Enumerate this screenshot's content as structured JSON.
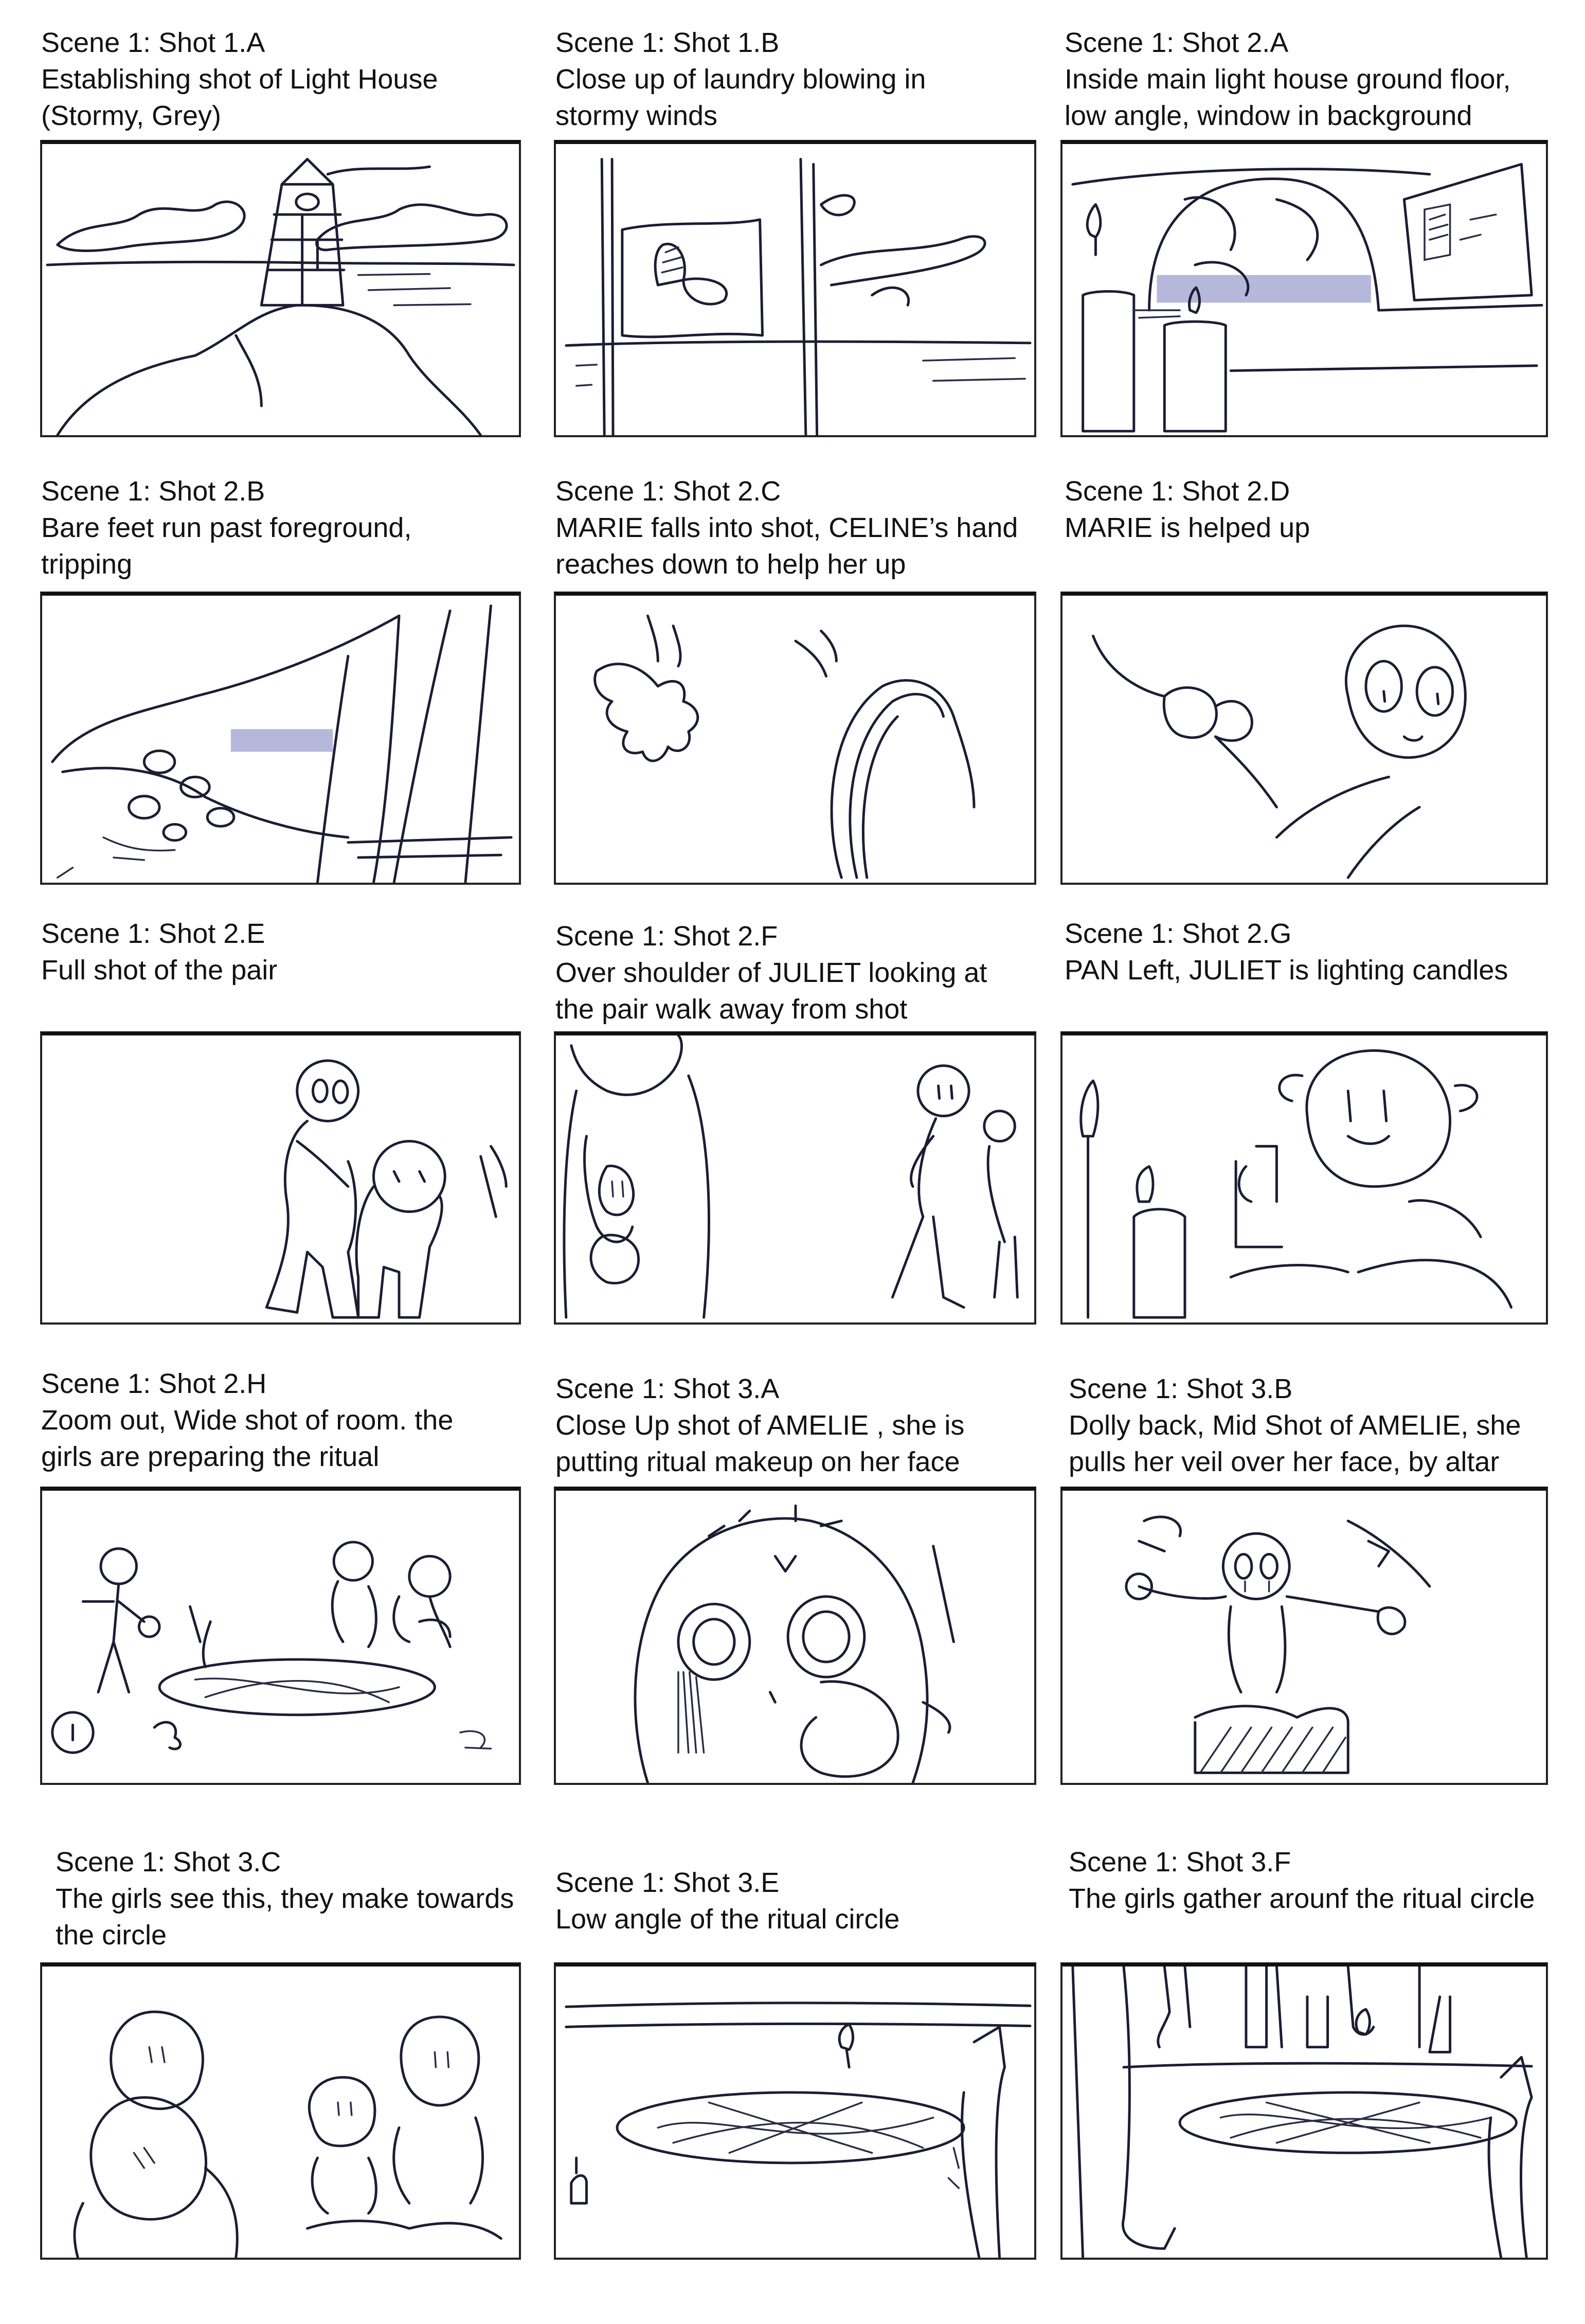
{
  "panels": [
    {
      "title": "Scene 1: Shot 1.A",
      "desc": "Establishing shot of Light House\n(Stormy, Grey)",
      "sketch": "lighthouse-sketch"
    },
    {
      "title": "Scene 1: Shot 1.B",
      "desc": "Close up of laundry blowing in\nstormy winds",
      "sketch": "laundry-sketch"
    },
    {
      "title": "Scene 1: Shot 2.A",
      "desc": "Inside main light house ground floor,\nlow angle, window in background",
      "sketch": "window-candles-sketch"
    },
    {
      "title": "Scene 1: Shot 2.B",
      "desc": "Bare feet run past foreground,\ntripping",
      "sketch": "running-feet-sketch"
    },
    {
      "title": "Scene 1: Shot 2.C",
      "desc": "MARIE falls into shot, CELINE’s hand\nreaches down to help her up",
      "sketch": "helping-hand-sketch"
    },
    {
      "title": "Scene 1: Shot 2.D",
      "desc": "MARIE is helped up",
      "sketch": "helped-up-sketch"
    },
    {
      "title": "Scene 1: Shot 2.E",
      "desc": "Full shot of the pair",
      "sketch": "pair-sketch"
    },
    {
      "title": "Scene 1: Shot 2.F",
      "desc": "Over shoulder of JULIET looking at\nthe pair walk away from shot",
      "sketch": "over-shoulder-sketch"
    },
    {
      "title": "Scene 1: Shot 2.G",
      "desc": "PAN Left, JULIET is lighting candles",
      "sketch": "lighting-candles-sketch"
    },
    {
      "title": "Scene 1: Shot 2.H",
      "desc": "Zoom out, Wide shot of room. the\ngirls are preparing the ritual",
      "sketch": "wide-room-sketch"
    },
    {
      "title": "Scene 1: Shot 3.A",
      "desc": "Close Up shot of AMELIE , she is\nputting ritual makeup on her face",
      "sketch": "amelie-closeup-sketch"
    },
    {
      "title": "Scene 1: Shot 3.B",
      "desc": "Dolly back, Mid Shot of AMELIE, she\npulls her veil over her face, by altar",
      "sketch": "altar-sketch"
    },
    {
      "title": "Scene 1: Shot 3.C",
      "desc": "The girls see this, they make towards\nthe circle",
      "sketch": "girls-heads-sketch"
    },
    {
      "title": "Scene 1: Shot 3.E",
      "desc": "Low angle of the ritual circle",
      "sketch": "ritual-circle-sketch"
    },
    {
      "title": "Scene 1: Shot 3.F",
      "desc": "The girls gather arounf the ritual circle",
      "sketch": "gather-circle-sketch"
    }
  ],
  "colors": {
    "ink": "#1c1d33",
    "tint": "#a8abd3",
    "paper": "#ffffff"
  }
}
